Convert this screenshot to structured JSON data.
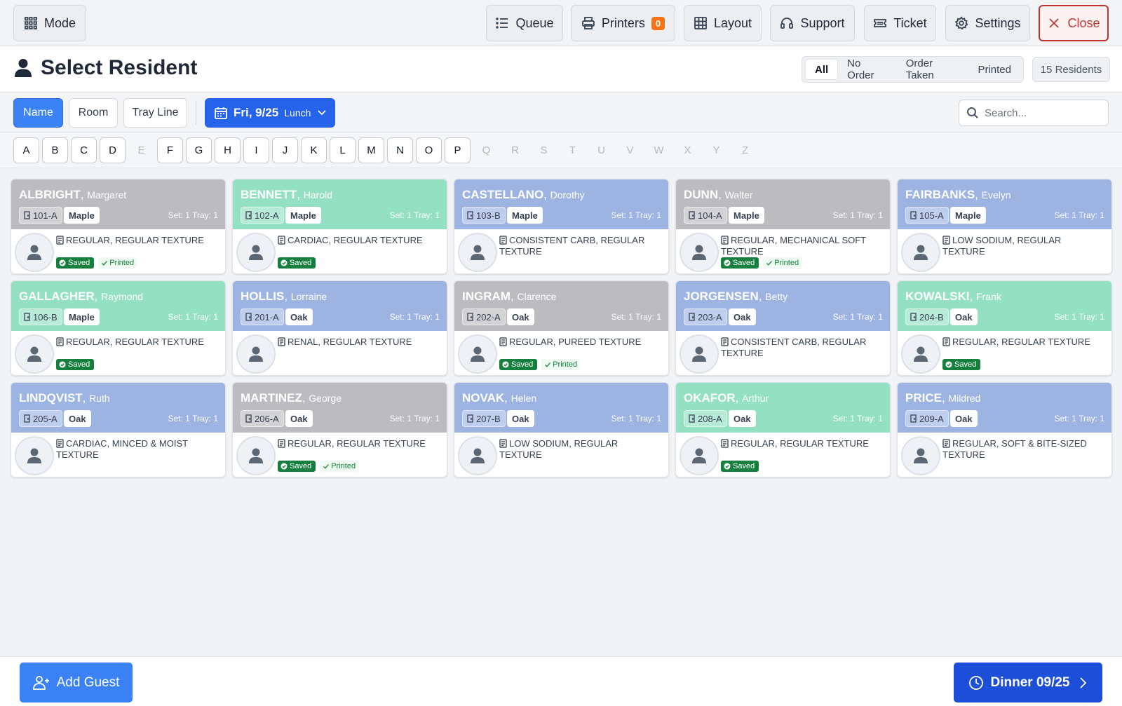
{
  "toolbar": {
    "mode_label": "Mode",
    "queue_label": "Queue",
    "printers_label": "Printers",
    "printers_count": "0",
    "layout_label": "Layout",
    "support_label": "Support",
    "ticket_label": "Ticket",
    "settings_label": "Settings",
    "close_label": "Close"
  },
  "header": {
    "title": "Select Resident",
    "filters": [
      "All",
      "No Order",
      "Order Taken",
      "Printed"
    ],
    "active_filter": "All",
    "resident_count": "15 Residents"
  },
  "sort": {
    "options": [
      "Name",
      "Room",
      "Tray Line"
    ],
    "active": "Name",
    "date_label": "Fri, 9/25",
    "meal_label": "Lunch",
    "search_placeholder": "Search..."
  },
  "letters": [
    {
      "l": "A",
      "on": true
    },
    {
      "l": "B",
      "on": true
    },
    {
      "l": "C",
      "on": true
    },
    {
      "l": "D",
      "on": true
    },
    {
      "l": "E",
      "on": false
    },
    {
      "l": "F",
      "on": true
    },
    {
      "l": "G",
      "on": true
    },
    {
      "l": "H",
      "on": true
    },
    {
      "l": "I",
      "on": true
    },
    {
      "l": "J",
      "on": true
    },
    {
      "l": "K",
      "on": true
    },
    {
      "l": "L",
      "on": true
    },
    {
      "l": "M",
      "on": true
    },
    {
      "l": "N",
      "on": true
    },
    {
      "l": "O",
      "on": true
    },
    {
      "l": "P",
      "on": true
    },
    {
      "l": "Q",
      "on": false
    },
    {
      "l": "R",
      "on": false
    },
    {
      "l": "S",
      "on": false
    },
    {
      "l": "T",
      "on": false
    },
    {
      "l": "U",
      "on": false
    },
    {
      "l": "V",
      "on": false
    },
    {
      "l": "W",
      "on": false
    },
    {
      "l": "X",
      "on": false
    },
    {
      "l": "Y",
      "on": false
    },
    {
      "l": "Z",
      "on": false
    }
  ],
  "colors": {
    "status_gray": "#bcbbbf",
    "status_green": "#93e0c2",
    "status_blue": "#9db4e2",
    "saved_green": "#15803d",
    "primary_blue": "#3b82f6",
    "close_red": "#c03434"
  },
  "status_labels": {
    "saved": "Saved",
    "printed": "Printed"
  },
  "residents": [
    {
      "last": "ALBRIGHT",
      "first": "Margaret",
      "room": "101-A",
      "unit": "Maple",
      "set": "Set: 1 Tray: 1",
      "diet": "REGULAR, REGULAR TEXTURE",
      "color": "gray",
      "saved": true,
      "printed": true
    },
    {
      "last": "BENNETT",
      "first": "Harold",
      "room": "102-A",
      "unit": "Maple",
      "set": "Set: 1 Tray: 1",
      "diet": "CARDIAC, REGULAR TEXTURE",
      "color": "green",
      "saved": true,
      "printed": false
    },
    {
      "last": "CASTELLANO",
      "first": "Dorothy",
      "room": "103-B",
      "unit": "Maple",
      "set": "Set: 1 Tray: 1",
      "diet": "CONSISTENT CARB, REGULAR TEXTURE",
      "color": "blue",
      "saved": false,
      "printed": false
    },
    {
      "last": "DUNN",
      "first": "Walter",
      "room": "104-A",
      "unit": "Maple",
      "set": "Set: 1 Tray: 1",
      "diet": "REGULAR, MECHANICAL SOFT TEXTURE",
      "color": "gray",
      "saved": true,
      "printed": true
    },
    {
      "last": "FAIRBANKS",
      "first": "Evelyn",
      "room": "105-A",
      "unit": "Maple",
      "set": "Set: 1 Tray: 1",
      "diet": "LOW SODIUM, REGULAR TEXTURE",
      "color": "blue",
      "saved": false,
      "printed": false
    },
    {
      "last": "GALLAGHER",
      "first": "Raymond",
      "room": "106-B",
      "unit": "Maple",
      "set": "Set: 1 Tray: 1",
      "diet": "REGULAR, REGULAR TEXTURE",
      "color": "green",
      "saved": true,
      "printed": false
    },
    {
      "last": "HOLLIS",
      "first": "Lorraine",
      "room": "201-A",
      "unit": "Oak",
      "set": "Set: 1 Tray: 1",
      "diet": "RENAL, REGULAR TEXTURE",
      "color": "blue",
      "saved": false,
      "printed": false
    },
    {
      "last": "INGRAM",
      "first": "Clarence",
      "room": "202-A",
      "unit": "Oak",
      "set": "Set: 1 Tray: 1",
      "diet": "REGULAR, PUREED TEXTURE",
      "color": "gray",
      "saved": true,
      "printed": true
    },
    {
      "last": "JORGENSEN",
      "first": "Betty",
      "room": "203-A",
      "unit": "Oak",
      "set": "Set: 1 Tray: 1",
      "diet": "CONSISTENT CARB, REGULAR TEXTURE",
      "color": "blue",
      "saved": false,
      "printed": false
    },
    {
      "last": "KOWALSKI",
      "first": "Frank",
      "room": "204-B",
      "unit": "Oak",
      "set": "Set: 1 Tray: 1",
      "diet": "REGULAR, REGULAR TEXTURE",
      "color": "green",
      "saved": true,
      "printed": false
    },
    {
      "last": "LINDQVIST",
      "first": "Ruth",
      "room": "205-A",
      "unit": "Oak",
      "set": "Set: 1 Tray: 1",
      "diet": "CARDIAC, MINCED & MOIST TEXTURE",
      "color": "blue",
      "saved": false,
      "printed": false
    },
    {
      "last": "MARTINEZ",
      "first": "George",
      "room": "206-A",
      "unit": "Oak",
      "set": "Set: 1 Tray: 1",
      "diet": "REGULAR, REGULAR TEXTURE",
      "color": "gray",
      "saved": true,
      "printed": true
    },
    {
      "last": "NOVAK",
      "first": "Helen",
      "room": "207-B",
      "unit": "Oak",
      "set": "Set: 1 Tray: 1",
      "diet": "LOW SODIUM, REGULAR TEXTURE",
      "color": "blue",
      "saved": false,
      "printed": false
    },
    {
      "last": "OKAFOR",
      "first": "Arthur",
      "room": "208-A",
      "unit": "Oak",
      "set": "Set: 1 Tray: 1",
      "diet": "REGULAR, REGULAR TEXTURE",
      "color": "green",
      "saved": true,
      "printed": false
    },
    {
      "last": "PRICE",
      "first": "Mildred",
      "room": "209-A",
      "unit": "Oak",
      "set": "Set: 1 Tray: 1",
      "diet": "REGULAR, SOFT & BITE-SIZED TEXTURE",
      "color": "blue",
      "saved": false,
      "printed": false
    }
  ],
  "footer": {
    "add_guest_label": "Add Guest",
    "next_meal_label": "Dinner 09/25"
  }
}
